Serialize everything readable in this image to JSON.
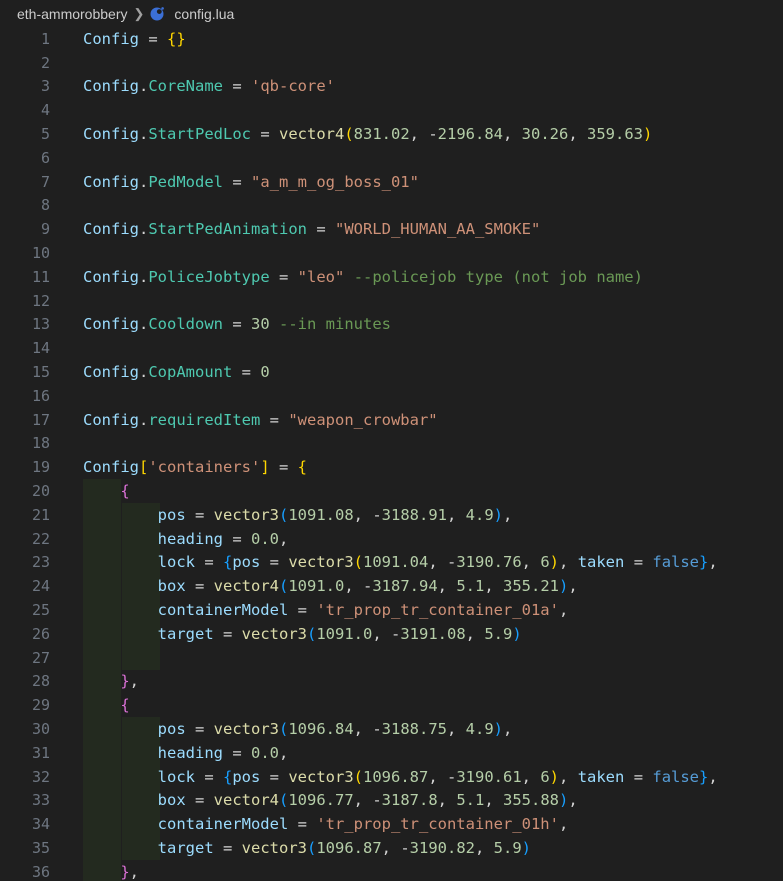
{
  "breadcrumb": {
    "folder": "eth-ammorobbery",
    "file": "config.lua",
    "file_icon": "lua-moon-icon"
  },
  "colors": {
    "background": "#1f1f1f",
    "line_number": "#6e7681",
    "string": "#ce9178",
    "number": "#b5cea8",
    "comment": "#6a9955",
    "function": "#dcdcaa",
    "keyword": "#569cd6",
    "class": "#4ec9b0",
    "field": "#9cdcfe"
  },
  "lines": [
    {
      "n": "1",
      "tokens": [
        [
          "tk-id",
          "Config"
        ],
        [
          "tk-op",
          " = "
        ],
        [
          "tk-b1",
          "{}"
        ]
      ]
    },
    {
      "n": "2",
      "tokens": []
    },
    {
      "n": "3",
      "tokens": [
        [
          "tk-id",
          "Config"
        ],
        [
          "tk-op",
          "."
        ],
        [
          "tk-prop",
          "CoreName"
        ],
        [
          "tk-op",
          " = "
        ],
        [
          "tk-str",
          "'qb-core'"
        ]
      ]
    },
    {
      "n": "4",
      "tokens": []
    },
    {
      "n": "5",
      "tokens": [
        [
          "tk-id",
          "Config"
        ],
        [
          "tk-op",
          "."
        ],
        [
          "tk-prop",
          "StartPedLoc"
        ],
        [
          "tk-op",
          " = "
        ],
        [
          "tk-fn",
          "vector4"
        ],
        [
          "tk-b1",
          "("
        ],
        [
          "tk-num",
          "831.02"
        ],
        [
          "tk-op",
          ", -"
        ],
        [
          "tk-num",
          "2196.84"
        ],
        [
          "tk-op",
          ", "
        ],
        [
          "tk-num",
          "30.26"
        ],
        [
          "tk-op",
          ", "
        ],
        [
          "tk-num",
          "359.63"
        ],
        [
          "tk-b1",
          ")"
        ]
      ]
    },
    {
      "n": "6",
      "tokens": []
    },
    {
      "n": "7",
      "tokens": [
        [
          "tk-id",
          "Config"
        ],
        [
          "tk-op",
          "."
        ],
        [
          "tk-prop",
          "PedModel"
        ],
        [
          "tk-op",
          " = "
        ],
        [
          "tk-str",
          "\"a_m_m_og_boss_01\""
        ]
      ]
    },
    {
      "n": "8",
      "tokens": []
    },
    {
      "n": "9",
      "tokens": [
        [
          "tk-id",
          "Config"
        ],
        [
          "tk-op",
          "."
        ],
        [
          "tk-prop",
          "StartPedAnimation"
        ],
        [
          "tk-op",
          " = "
        ],
        [
          "tk-str",
          "\"WORLD_HUMAN_AA_SMOKE\""
        ]
      ]
    },
    {
      "n": "10",
      "tokens": []
    },
    {
      "n": "11",
      "tokens": [
        [
          "tk-id",
          "Config"
        ],
        [
          "tk-op",
          "."
        ],
        [
          "tk-prop",
          "PoliceJobtype"
        ],
        [
          "tk-op",
          " = "
        ],
        [
          "tk-str",
          "\"leo\""
        ],
        [
          "tk-op",
          " "
        ],
        [
          "tk-com",
          "--policejob type (not job name)"
        ]
      ]
    },
    {
      "n": "12",
      "tokens": []
    },
    {
      "n": "13",
      "tokens": [
        [
          "tk-id",
          "Config"
        ],
        [
          "tk-op",
          "."
        ],
        [
          "tk-prop",
          "Cooldown"
        ],
        [
          "tk-op",
          " = "
        ],
        [
          "tk-num",
          "30"
        ],
        [
          "tk-op",
          " "
        ],
        [
          "tk-com",
          "--in minutes"
        ]
      ]
    },
    {
      "n": "14",
      "tokens": []
    },
    {
      "n": "15",
      "tokens": [
        [
          "tk-id",
          "Config"
        ],
        [
          "tk-op",
          "."
        ],
        [
          "tk-prop",
          "CopAmount"
        ],
        [
          "tk-op",
          " = "
        ],
        [
          "tk-num",
          "0"
        ]
      ]
    },
    {
      "n": "16",
      "tokens": []
    },
    {
      "n": "17",
      "tokens": [
        [
          "tk-id",
          "Config"
        ],
        [
          "tk-op",
          "."
        ],
        [
          "tk-prop",
          "requiredItem"
        ],
        [
          "tk-op",
          " = "
        ],
        [
          "tk-str",
          "\"weapon_crowbar\""
        ]
      ]
    },
    {
      "n": "18",
      "tokens": []
    },
    {
      "n": "19",
      "tokens": [
        [
          "tk-id",
          "Config"
        ],
        [
          "tk-b1",
          "["
        ],
        [
          "tk-str",
          "'containers'"
        ],
        [
          "tk-b1",
          "]"
        ],
        [
          "tk-op",
          " = "
        ],
        [
          "tk-b1",
          "{"
        ]
      ]
    },
    {
      "n": "20",
      "tokens": [
        [
          "tk-op",
          "    "
        ],
        [
          "tk-b2",
          "{"
        ]
      ]
    },
    {
      "n": "21",
      "tokens": [
        [
          "tk-op",
          "        "
        ],
        [
          "tk-id",
          "pos"
        ],
        [
          "tk-op",
          " = "
        ],
        [
          "tk-fn",
          "vector3"
        ],
        [
          "tk-b3",
          "("
        ],
        [
          "tk-num",
          "1091.08"
        ],
        [
          "tk-op",
          ", -"
        ],
        [
          "tk-num",
          "3188.91"
        ],
        [
          "tk-op",
          ", "
        ],
        [
          "tk-num",
          "4.9"
        ],
        [
          "tk-b3",
          ")"
        ],
        [
          "tk-op",
          ","
        ]
      ]
    },
    {
      "n": "22",
      "tokens": [
        [
          "tk-op",
          "        "
        ],
        [
          "tk-id",
          "heading"
        ],
        [
          "tk-op",
          " = "
        ],
        [
          "tk-num",
          "0.0"
        ],
        [
          "tk-op",
          ","
        ]
      ]
    },
    {
      "n": "23",
      "tokens": [
        [
          "tk-op",
          "        "
        ],
        [
          "tk-id",
          "lock"
        ],
        [
          "tk-op",
          " = "
        ],
        [
          "tk-b3",
          "{"
        ],
        [
          "tk-id",
          "pos"
        ],
        [
          "tk-op",
          " = "
        ],
        [
          "tk-fn",
          "vector3"
        ],
        [
          "tk-b1",
          "("
        ],
        [
          "tk-num",
          "1091.04"
        ],
        [
          "tk-op",
          ", -"
        ],
        [
          "tk-num",
          "3190.76"
        ],
        [
          "tk-op",
          ", "
        ],
        [
          "tk-num",
          "6"
        ],
        [
          "tk-b1",
          ")"
        ],
        [
          "tk-op",
          ", "
        ],
        [
          "tk-id",
          "taken"
        ],
        [
          "tk-op",
          " = "
        ],
        [
          "tk-kw",
          "false"
        ],
        [
          "tk-b3",
          "}"
        ],
        [
          "tk-op",
          ","
        ]
      ]
    },
    {
      "n": "24",
      "tokens": [
        [
          "tk-op",
          "        "
        ],
        [
          "tk-id",
          "box"
        ],
        [
          "tk-op",
          " = "
        ],
        [
          "tk-fn",
          "vector4"
        ],
        [
          "tk-b3",
          "("
        ],
        [
          "tk-num",
          "1091.0"
        ],
        [
          "tk-op",
          ", -"
        ],
        [
          "tk-num",
          "3187.94"
        ],
        [
          "tk-op",
          ", "
        ],
        [
          "tk-num",
          "5.1"
        ],
        [
          "tk-op",
          ", "
        ],
        [
          "tk-num",
          "355.21"
        ],
        [
          "tk-b3",
          ")"
        ],
        [
          "tk-op",
          ","
        ]
      ]
    },
    {
      "n": "25",
      "tokens": [
        [
          "tk-op",
          "        "
        ],
        [
          "tk-id",
          "containerModel"
        ],
        [
          "tk-op",
          " = "
        ],
        [
          "tk-str",
          "'tr_prop_tr_container_01a'"
        ],
        [
          "tk-op",
          ","
        ]
      ]
    },
    {
      "n": "26",
      "tokens": [
        [
          "tk-op",
          "        "
        ],
        [
          "tk-id",
          "target"
        ],
        [
          "tk-op",
          " = "
        ],
        [
          "tk-fn",
          "vector3"
        ],
        [
          "tk-b3",
          "("
        ],
        [
          "tk-num",
          "1091.0"
        ],
        [
          "tk-op",
          ", -"
        ],
        [
          "tk-num",
          "3191.08"
        ],
        [
          "tk-op",
          ", "
        ],
        [
          "tk-num",
          "5.9"
        ],
        [
          "tk-b3",
          ")"
        ]
      ]
    },
    {
      "n": "27",
      "tokens": []
    },
    {
      "n": "28",
      "tokens": [
        [
          "tk-op",
          "    "
        ],
        [
          "tk-b2",
          "}"
        ],
        [
          "tk-op",
          ","
        ]
      ]
    },
    {
      "n": "29",
      "tokens": [
        [
          "tk-op",
          "    "
        ],
        [
          "tk-b2",
          "{"
        ]
      ]
    },
    {
      "n": "30",
      "tokens": [
        [
          "tk-op",
          "        "
        ],
        [
          "tk-id",
          "pos"
        ],
        [
          "tk-op",
          " = "
        ],
        [
          "tk-fn",
          "vector3"
        ],
        [
          "tk-b3",
          "("
        ],
        [
          "tk-num",
          "1096.84"
        ],
        [
          "tk-op",
          ", -"
        ],
        [
          "tk-num",
          "3188.75"
        ],
        [
          "tk-op",
          ", "
        ],
        [
          "tk-num",
          "4.9"
        ],
        [
          "tk-b3",
          ")"
        ],
        [
          "tk-op",
          ","
        ]
      ]
    },
    {
      "n": "31",
      "tokens": [
        [
          "tk-op",
          "        "
        ],
        [
          "tk-id",
          "heading"
        ],
        [
          "tk-op",
          " = "
        ],
        [
          "tk-num",
          "0.0"
        ],
        [
          "tk-op",
          ","
        ]
      ]
    },
    {
      "n": "32",
      "tokens": [
        [
          "tk-op",
          "        "
        ],
        [
          "tk-id",
          "lock"
        ],
        [
          "tk-op",
          " = "
        ],
        [
          "tk-b3",
          "{"
        ],
        [
          "tk-id",
          "pos"
        ],
        [
          "tk-op",
          " = "
        ],
        [
          "tk-fn",
          "vector3"
        ],
        [
          "tk-b1",
          "("
        ],
        [
          "tk-num",
          "1096.87"
        ],
        [
          "tk-op",
          ", -"
        ],
        [
          "tk-num",
          "3190.61"
        ],
        [
          "tk-op",
          ", "
        ],
        [
          "tk-num",
          "6"
        ],
        [
          "tk-b1",
          ")"
        ],
        [
          "tk-op",
          ", "
        ],
        [
          "tk-id",
          "taken"
        ],
        [
          "tk-op",
          " = "
        ],
        [
          "tk-kw",
          "false"
        ],
        [
          "tk-b3",
          "}"
        ],
        [
          "tk-op",
          ","
        ]
      ]
    },
    {
      "n": "33",
      "tokens": [
        [
          "tk-op",
          "        "
        ],
        [
          "tk-id",
          "box"
        ],
        [
          "tk-op",
          " = "
        ],
        [
          "tk-fn",
          "vector4"
        ],
        [
          "tk-b3",
          "("
        ],
        [
          "tk-num",
          "1096.77"
        ],
        [
          "tk-op",
          ", -"
        ],
        [
          "tk-num",
          "3187.8"
        ],
        [
          "tk-op",
          ", "
        ],
        [
          "tk-num",
          "5.1"
        ],
        [
          "tk-op",
          ", "
        ],
        [
          "tk-num",
          "355.88"
        ],
        [
          "tk-b3",
          ")"
        ],
        [
          "tk-op",
          ","
        ]
      ]
    },
    {
      "n": "34",
      "tokens": [
        [
          "tk-op",
          "        "
        ],
        [
          "tk-id",
          "containerModel"
        ],
        [
          "tk-op",
          " = "
        ],
        [
          "tk-str",
          "'tr_prop_tr_container_01h'"
        ],
        [
          "tk-op",
          ","
        ]
      ]
    },
    {
      "n": "35",
      "tokens": [
        [
          "tk-op",
          "        "
        ],
        [
          "tk-id",
          "target"
        ],
        [
          "tk-op",
          " = "
        ],
        [
          "tk-fn",
          "vector3"
        ],
        [
          "tk-b3",
          "("
        ],
        [
          "tk-num",
          "1096.87"
        ],
        [
          "tk-op",
          ", -"
        ],
        [
          "tk-num",
          "3190.82"
        ],
        [
          "tk-op",
          ", "
        ],
        [
          "tk-num",
          "5.9"
        ],
        [
          "tk-b3",
          ")"
        ]
      ]
    },
    {
      "n": "36",
      "tokens": [
        [
          "tk-op",
          "    "
        ],
        [
          "tk-b2",
          "}"
        ],
        [
          "tk-op",
          ","
        ]
      ]
    }
  ]
}
